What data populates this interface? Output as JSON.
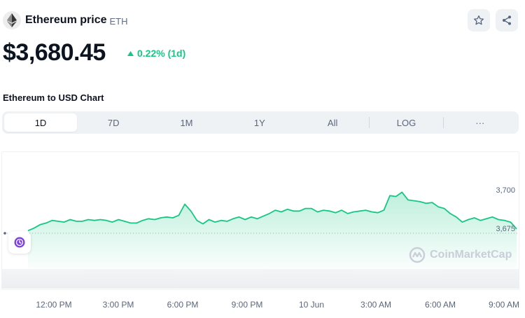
{
  "header": {
    "coin_name": "Ethereum price",
    "coin_symbol": "ETH",
    "logo_icon": "ethereum-logo-icon",
    "star_icon": "star-icon",
    "share_icon": "share-icon"
  },
  "price": {
    "value": "$3,680.45",
    "change": "0.22% (1d)",
    "direction": "up",
    "change_color": "#16c784"
  },
  "chart_section": {
    "heading": "Ethereum to USD Chart",
    "tabs": [
      "1D",
      "7D",
      "1M",
      "1Y",
      "All",
      "LOG",
      "···"
    ],
    "active_tab": "1D"
  },
  "chart_data": {
    "type": "area",
    "series": [
      {
        "values": [
          3676.5,
          3678.0,
          3680.0,
          3681.0,
          3682.5,
          3682.0,
          3681.5,
          3683.0,
          3682.0,
          3682.0,
          3683.0,
          3682.5,
          3683.0,
          3682.5,
          3681.5,
          3683.0,
          3682.0,
          3681.0,
          3681.0,
          3682.5,
          3683.5,
          3683.0,
          3684.0,
          3684.5,
          3684.0,
          3685.5,
          3692.0,
          3688.0,
          3682.5,
          3680.5,
          3683.0,
          3681.5,
          3682.5,
          3682.0,
          3683.5,
          3684.5,
          3683.0,
          3684.5,
          3683.5,
          3685.0,
          3686.5,
          3688.5,
          3687.5,
          3689.0,
          3688.0,
          3688.0,
          3689.5,
          3689.5,
          3687.5,
          3688.5,
          3688.0,
          3687.0,
          3688.5,
          3686.5,
          3687.5,
          3688.0,
          3688.5,
          3687.5,
          3687.0,
          3688.5,
          3697.0,
          3696.5,
          3699.0,
          3694.5,
          3694.0,
          3693.5,
          3692.5,
          3693.0,
          3690.5,
          3689.5,
          3686.5,
          3684.5,
          3681.5,
          3683.0,
          3684.0,
          3682.5,
          3683.5,
          3684.5,
          3683.0,
          3682.5,
          3681.5,
          3677.5
        ],
        "color": "#16c784"
      }
    ],
    "x_ticks": [
      "12:00 PM",
      "3:00 PM",
      "6:00 PM",
      "9:00 PM",
      "10 Jun",
      "3:00 AM",
      "6:00 AM",
      "9:00 AM"
    ],
    "y_ticks": [
      "3,700",
      "3,675"
    ],
    "reference_line": 3675,
    "ylim": [
      3668,
      3710
    ],
    "grid": false,
    "watermark": "CoinMarketCap"
  },
  "history_icon": "history-clock-icon"
}
